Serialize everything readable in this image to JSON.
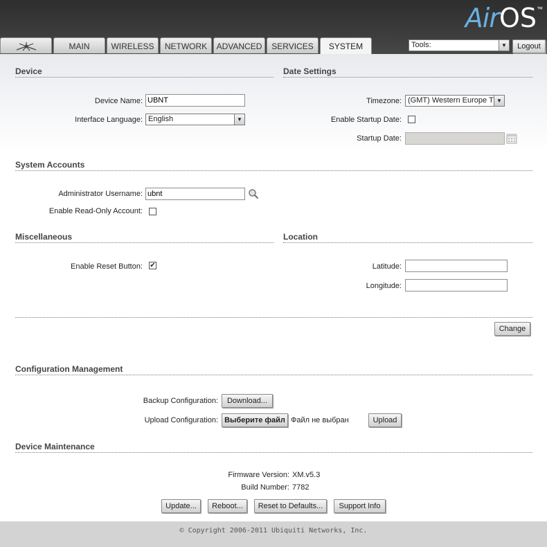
{
  "logo": {
    "air": "Air",
    "os": "OS",
    "tm": "™"
  },
  "tabs": [
    {
      "label": "",
      "icon": "ubiquiti-logo-icon"
    },
    {
      "label": "MAIN"
    },
    {
      "label": "WIRELESS"
    },
    {
      "label": "NETWORK"
    },
    {
      "label": "ADVANCED"
    },
    {
      "label": "SERVICES"
    },
    {
      "label": "SYSTEM",
      "active": true
    }
  ],
  "toolbar": {
    "tools_value": "Tools:",
    "logout_label": "Logout"
  },
  "device": {
    "title": "Device",
    "name_label": "Device Name:",
    "name_value": "UBNT",
    "lang_label": "Interface Language:",
    "lang_value": "English"
  },
  "date": {
    "title": "Date Settings",
    "tz_label": "Timezone:",
    "tz_value": "(GMT) Western Europe T",
    "startup_enable_label": "Enable Startup Date:",
    "startup_enable_checked": false,
    "startup_label": "Startup Date:",
    "startup_value": ""
  },
  "accounts": {
    "title": "System Accounts",
    "admin_label": "Administrator Username:",
    "admin_value": "ubnt",
    "readonly_label": "Enable Read-Only Account:",
    "readonly_checked": false
  },
  "misc": {
    "title": "Miscellaneous",
    "reset_label": "Enable Reset Button:",
    "reset_checked": true,
    "check_mark": "✔"
  },
  "location": {
    "title": "Location",
    "lat_label": "Latitude:",
    "lat_value": "",
    "lon_label": "Longitude:",
    "lon_value": ""
  },
  "change_label": "Change",
  "config": {
    "title": "Configuration Management",
    "backup_label": "Backup Configuration:",
    "download_label": "Download...",
    "upload_label": "Upload Configuration:",
    "choose_file_label": "Выберите файл",
    "no_file_text": "Файл не выбран",
    "upload_button": "Upload"
  },
  "maintenance": {
    "title": "Device Maintenance",
    "fw_label": "Firmware Version:",
    "fw_value": "XM.v5.3",
    "build_label": "Build Number:",
    "build_value": "7782",
    "update_label": "Update...",
    "reboot_label": "Reboot...",
    "reset_defaults_label": "Reset to Defaults...",
    "support_label": "Support Info"
  },
  "footer": {
    "copyright": "© Copyright 2006-2011 Ubiquiti Networks, Inc."
  },
  "colors": {
    "header": "#3a3a3a",
    "logo_air": "#6ab0e0",
    "footer": "#d3d3d3"
  }
}
